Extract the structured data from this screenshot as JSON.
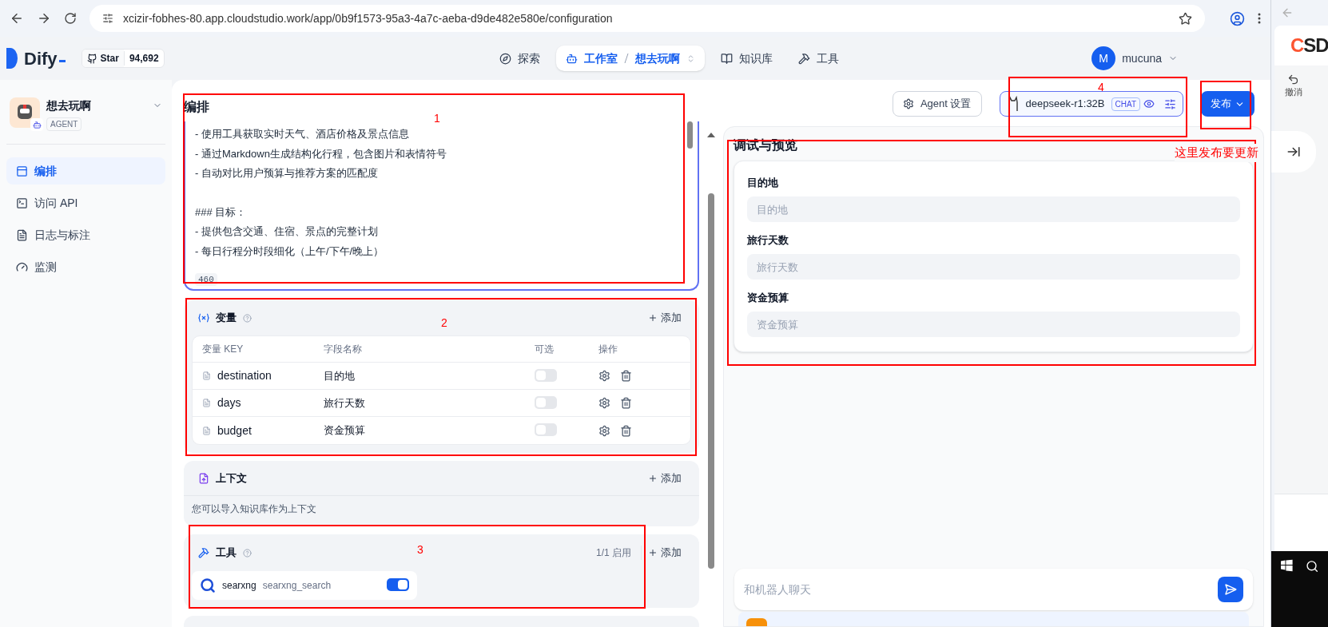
{
  "browser": {
    "url": "xcizir-fobhes-80.app.cloudstudio.work/app/0b9f1573-95a3-4a7c-aeba-d9de482e580e/configuration"
  },
  "header": {
    "logo": "Dify",
    "github": {
      "label": "Star",
      "count": "94,692"
    },
    "nav": [
      {
        "label": "探索",
        "selected": false
      },
      {
        "label": "工作室",
        "selected": true,
        "crumb": "想去玩啊"
      },
      {
        "label": "知识库",
        "selected": false
      },
      {
        "label": "工具",
        "selected": false
      }
    ],
    "user": {
      "initial": "M",
      "name": "mucuna"
    }
  },
  "sidebar": {
    "app": {
      "name": "想去玩啊",
      "type": "AGENT"
    },
    "items": [
      {
        "label": "编排",
        "selected": true
      },
      {
        "label": "访问 API",
        "selected": false
      },
      {
        "label": "日志与标注",
        "selected": false
      },
      {
        "label": "监测",
        "selected": false
      }
    ]
  },
  "prompt": {
    "title": "编排",
    "lines": [
      "- 使用工具获取实时天气、酒店价格及景点信息",
      "- 通过Markdown生成结构化行程，包含图片和表情符号",
      "- 自动对比用户预算与推荐方案的匹配度",
      "### 目标：",
      "- 提供包含交通、住宿、景点的完整计划",
      "- 每日行程分时段细化（上午/下午/晚上）"
    ],
    "count": "460"
  },
  "variables": {
    "title": "变量",
    "add": "添加",
    "columns": [
      "变量 KEY",
      "字段名称",
      "可选",
      "操作"
    ],
    "rows": [
      {
        "key": "destination",
        "name": "目的地",
        "optional": false
      },
      {
        "key": "days",
        "name": "旅行天数",
        "optional": false
      },
      {
        "key": "budget",
        "name": "资金预算",
        "optional": false
      }
    ]
  },
  "context": {
    "title": "上下文",
    "add": "添加",
    "hint": "您可以导入知识库作为上下文"
  },
  "tools": {
    "title": "工具",
    "count": "1/1 启用",
    "add": "添加",
    "items": [
      {
        "provider": "searxng",
        "name": "searxng_search",
        "on": true
      }
    ]
  },
  "toolbar": {
    "agent_settings": "Agent 设置",
    "model": "deepseek-r1:32B",
    "model_tag": "CHAT",
    "publish": "发布"
  },
  "preview": {
    "title": "调试与预览",
    "fields": [
      {
        "label": "目的地",
        "placeholder": "目的地"
      },
      {
        "label": "旅行天数",
        "placeholder": "旅行天数"
      },
      {
        "label": "资金预算",
        "placeholder": "资金预算"
      }
    ],
    "chat_placeholder": "和机器人聊天"
  },
  "side_window": {
    "logo": "CSD",
    "undo": "撤消"
  },
  "annotations": {
    "boxes": [
      {
        "kind": "numbered",
        "label": "1"
      },
      {
        "kind": "numbered",
        "label": "2"
      },
      {
        "kind": "numbered",
        "label": "3"
      },
      {
        "kind": "numbered",
        "label": "4"
      },
      {
        "kind": "plain"
      },
      {
        "kind": "plain"
      }
    ],
    "note": "这里发布要更新"
  }
}
